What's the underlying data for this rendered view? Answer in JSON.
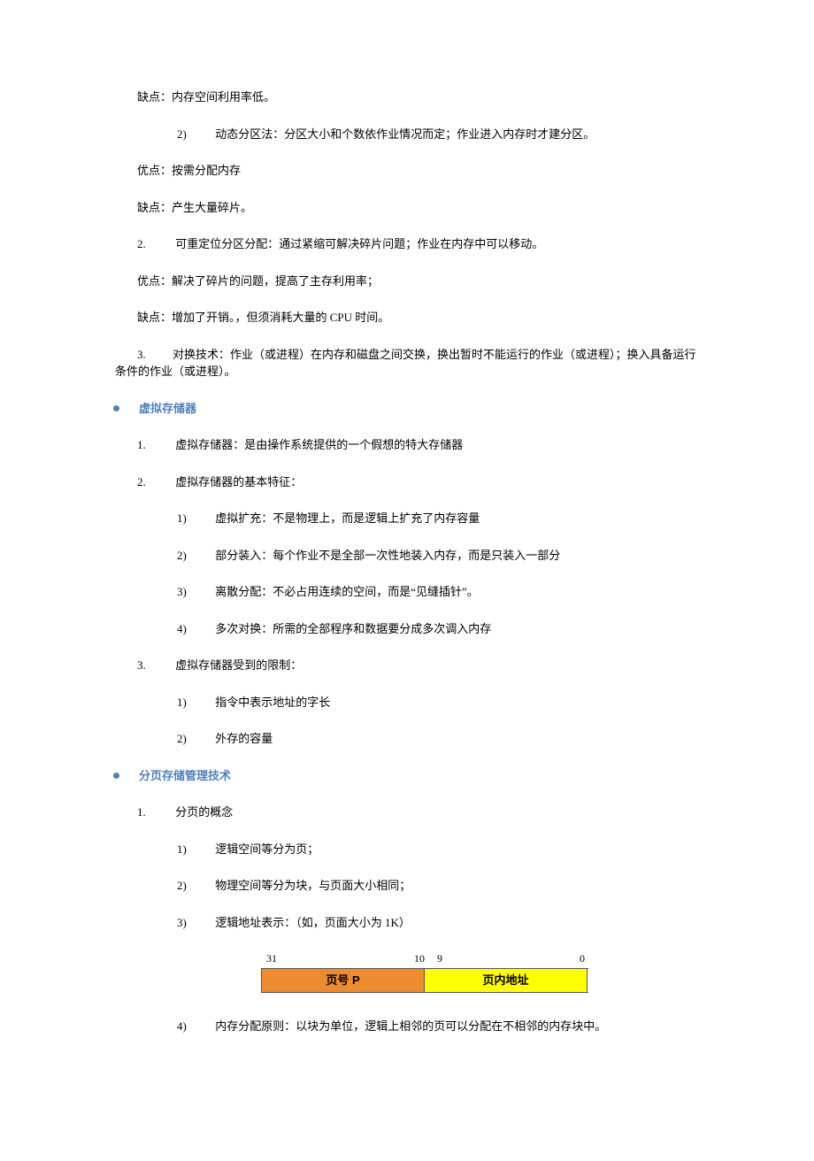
{
  "p1": "缺点：内存空间利用率低。",
  "p2_num": "2)",
  "p2": "动态分区法：分区大小和个数依作业情况而定；作业进入内存时才建分区。",
  "p3": "优点：按需分配内存",
  "p4": "缺点：产生大量碎片。",
  "p5_num": "2.",
  "p5": "可重定位分区分配：通过紧缩可解决碎片问题；作业在内存中可以移动。",
  "p6": "优点：解决了碎片的问题，提高了主存利用率；",
  "p7": "缺点：增加了开销。，但须消耗大量的 CPU 时间。",
  "p8_num": "3.",
  "p8": "对换技术：作业（或进程）在内存和磁盘之间交换，换出暂时不能运行的作业（或进程）；换入具备运行条件的作业（或进程）。",
  "sec1": "虚拟存储器",
  "s1_1_num": "1.",
  "s1_1": "虚拟存储器：是由操作系统提供的一个假想的特大存储器",
  "s1_2_num": "2.",
  "s1_2": "虚拟存储器的基本特征：",
  "s1_2_1_num": "1)",
  "s1_2_1": "虚拟扩充：不是物理上，而是逻辑上扩充了内存容量",
  "s1_2_2_num": "2)",
  "s1_2_2": "部分装入：每个作业不是全部一次性地装入内存，而是只装入一部分",
  "s1_2_3_num": "3)",
  "s1_2_3": "离散分配：不必占用连续的空间，而是“见缝插针”。",
  "s1_2_4_num": "4)",
  "s1_2_4": "多次对换：所需的全部程序和数据要分成多次调入内存",
  "s1_3_num": "3.",
  "s1_3": "虚拟存储器受到的限制：",
  "s1_3_1_num": "1)",
  "s1_3_1": "指令中表示地址的字长",
  "s1_3_2_num": "2)",
  "s1_3_2": "外存的容量",
  "sec2": "分页存储管理技术",
  "s2_1_num": "1.",
  "s2_1": "分页的概念",
  "s2_1_1_num": "1)",
  "s2_1_1": "逻辑空间等分为页；",
  "s2_1_2_num": "2)",
  "s2_1_2": "物理空间等分为块，与页面大小相同；",
  "s2_1_3_num": "3)",
  "s2_1_3": "逻辑地址表示：（如，页面大小为 1K）",
  "bits": {
    "b31": "31",
    "b10": "10",
    "b9": "9",
    "b0": "0"
  },
  "box_left": "页号 P",
  "box_right": "页内地址",
  "s2_1_4_num": "4)",
  "s2_1_4": "内存分配原则：以块为单位，逻辑上相邻的页可以分配在不相邻的内存块中。"
}
